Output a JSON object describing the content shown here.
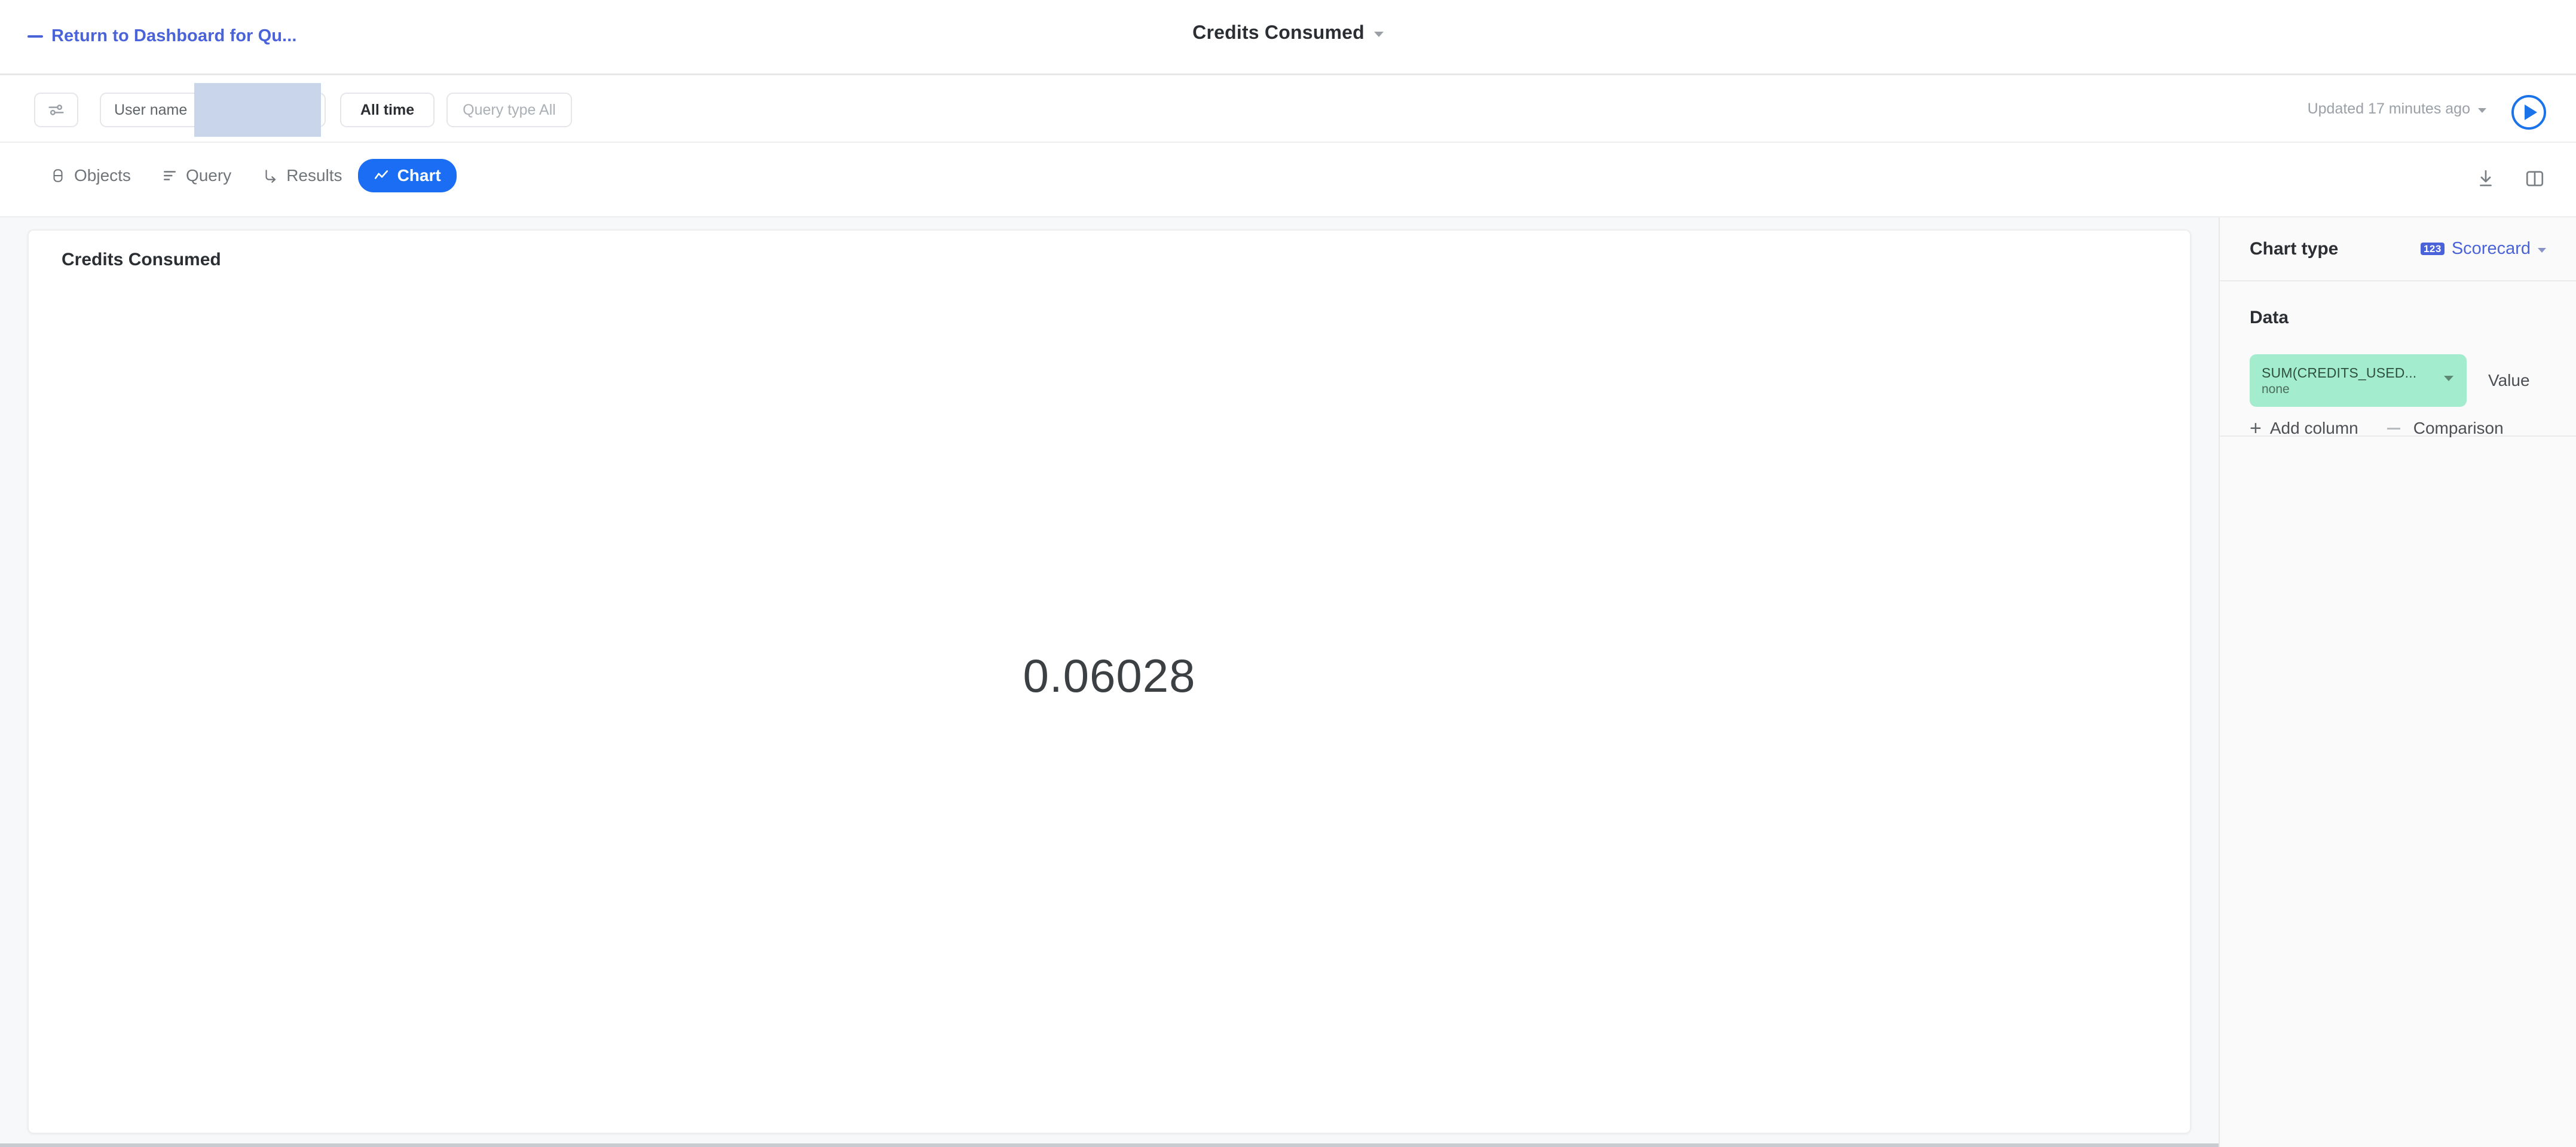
{
  "header": {
    "back_label": "Return to Dashboard for Qu...",
    "back_icon": "minus-icon",
    "title": "Credits Consumed",
    "title_caret_icon": "chevron-down-icon"
  },
  "filter_bar": {
    "settings_icon": "sliders-icon",
    "user_name": {
      "label": "User name",
      "value": "",
      "redacted": true
    },
    "time_range": {
      "label": "All time"
    },
    "query_type": {
      "placeholder": "Query type All"
    },
    "updated_text": "Updated 17 minutes ago",
    "updated_caret_icon": "chevron-down-icon",
    "run_button_icon": "play-icon"
  },
  "tab_bar": {
    "tabs": [
      {
        "label": "Objects",
        "icon": "database-icon",
        "active": false
      },
      {
        "label": "Query",
        "icon": "query-lines-icon",
        "active": false
      },
      {
        "label": "Results",
        "icon": "arrow-turn-icon",
        "active": false
      },
      {
        "label": "Chart",
        "icon": "line-chart-icon",
        "active": true
      }
    ],
    "actions": [
      {
        "icon": "download-icon"
      },
      {
        "icon": "split-panel-icon"
      }
    ]
  },
  "chart_card": {
    "title": "Credits Consumed",
    "value": "0.06028"
  },
  "chart_data": {
    "type": "table",
    "title": "Credits Consumed",
    "categories": [
      "Credits Consumed"
    ],
    "values": [
      0.06028
    ],
    "value_display": "0.06028",
    "measure": "SUM(CREDITS_USED...)",
    "aggregation": "none",
    "xlabel": "",
    "ylabel": ""
  },
  "sidebar": {
    "chart_type": {
      "label": "Chart type",
      "value": "Scorecard",
      "badge": "123",
      "caret_icon": "chevron-down-icon"
    },
    "data": {
      "label": "Data",
      "column_chip": {
        "name": "SUM(CREDITS_USED...",
        "sub": "none",
        "caret_icon": "chevron-down-icon"
      },
      "value_label": "Value",
      "add_column_label": "Add column",
      "add_column_icon": "plus-icon",
      "comparison_label": "Comparison",
      "comparison_icon": "minus-icon"
    }
  },
  "colors": {
    "accent_blue": "#1b6ef3",
    "link_blue": "#4a63d8",
    "chip_green": "#a3ecce",
    "redact_blue": "#c9d5ea",
    "canvas_bg": "#f7f8f9"
  }
}
